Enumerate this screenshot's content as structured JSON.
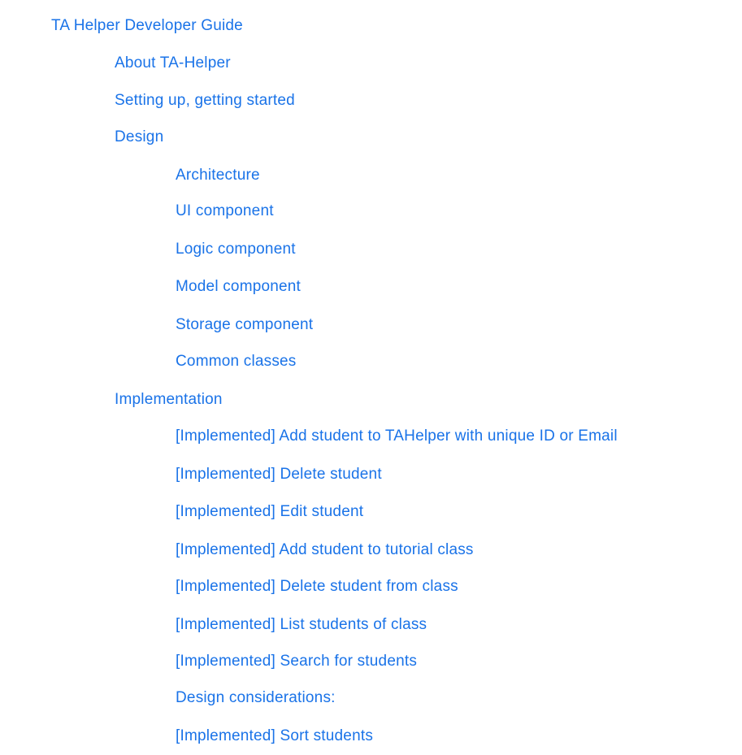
{
  "toc": {
    "title": "TA Helper Developer Guide",
    "about": "About TA-Helper",
    "setup": "Setting up, getting started",
    "design": {
      "label": "Design",
      "items": [
        "Architecture",
        "UI component",
        "Logic component",
        "Model component",
        "Storage component",
        "Common classes"
      ]
    },
    "implementation": {
      "label": "Implementation",
      "items": [
        "[Implemented] Add student to TAHelper with unique ID or Email",
        "[Implemented] Delete student",
        "[Implemented] Edit student",
        "[Implemented] Add student to tutorial class",
        "[Implemented] Delete student from class",
        "[Implemented] List students of class",
        "[Implemented] Search for students",
        "Design considerations:",
        "[Implemented] Sort students"
      ]
    }
  },
  "colors": {
    "link": "#1a73e8",
    "background": "#ffffff"
  }
}
